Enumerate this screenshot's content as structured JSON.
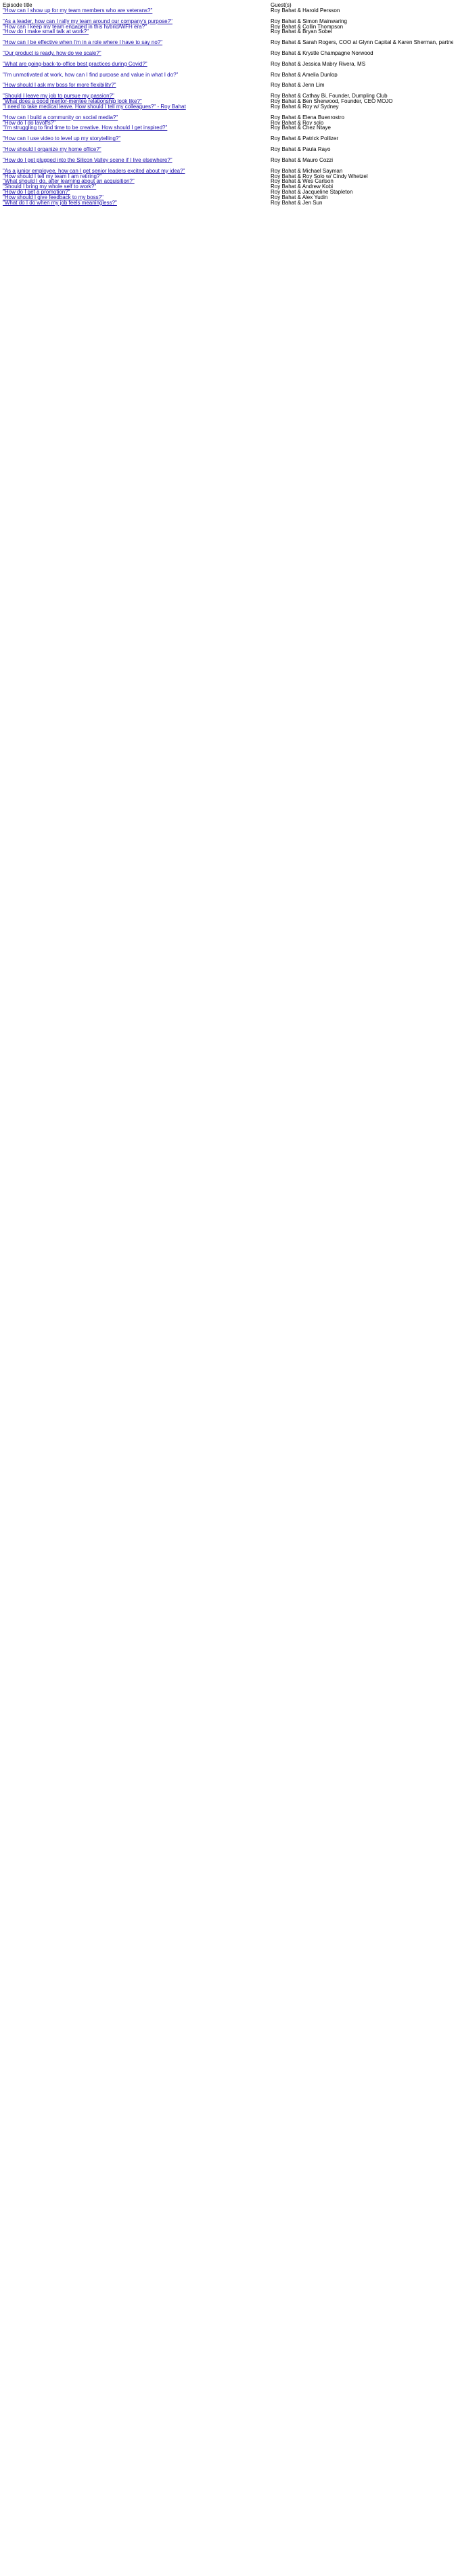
{
  "headers": {
    "title": "Episode title",
    "guests": "Guest(s)"
  },
  "colors": {
    "link": "#1a0dab",
    "text": "#000000",
    "background": "#ffffff"
  },
  "groups": [
    {
      "rows": [
        {
          "title": "\"How can I show up for my team members who are veterans?\"",
          "guest": "Roy Bahat & Harold Persson"
        }
      ]
    },
    {
      "rows": [
        {
          "title": "\"As a leader, how can I rally my team around our company's purpose?\"",
          "guest": "Roy Bahat & Simon Mainwaring"
        },
        {
          "title": "\"How can I keep my team engaged in this hybrid/WFH era?\"",
          "guest": "Roy Bahat & Collin Thompson"
        },
        {
          "title": "\"How do I make small talk at work?\"",
          "guest": "Roy Bahat & Bryan Sobel"
        }
      ]
    },
    {
      "rows": [
        {
          "title": "\"How can I be effective when I'm in a role where I have to say no?\"",
          "guest": "Roy Bahat & Sarah Rogers, COO at Glynn Capital & Karen Sherman, partner at Greylock"
        }
      ]
    },
    {
      "rows": [
        {
          "title": "\"Our product is ready, how do we scale?\"",
          "guest": "Roy Bahat & Krystle Champagne Norwood"
        }
      ]
    },
    {
      "rows": [
        {
          "title": "\"What are going-back-to-office best practices during Covid?\"",
          "guest": "Roy Bahat & Jessica Mabry Rivera, MS"
        }
      ]
    },
    {
      "rows": [
        {
          "title": "\"I'm unmotivated at work, how can I find purpose and value in what I do?\"",
          "guest": "Roy Bahat & Amelia Dunlop"
        }
      ]
    },
    {
      "rows": [
        {
          "title": "\"How should I ask my boss for more flexibility?\"",
          "guest": "Roy Bahat & Jenn Lim"
        }
      ]
    },
    {
      "rows": [
        {
          "title": "\"Should I leave my job to pursue my passion?\"",
          "guest": "Roy Bahat & Cathay Bi, Founder, Dumpling Club"
        },
        {
          "title": "\"What does a good mentor-mentee relationship look like?\"",
          "guest": "Roy Bahat & Ben Sherwood, Founder, CEO MOJO"
        },
        {
          "title": "\"I need to take medical leave. How should I tell my colleagues?\" - Roy Bahat",
          "guest": "Roy Bahat & Roy w/ Sydney"
        }
      ]
    },
    {
      "rows": [
        {
          "title": "\"How can I build a community on social media?\"",
          "guest": "Roy Bahat & Elena Buenrostro"
        },
        {
          "title": "\"How do I do layoffs?\"",
          "guest": "Roy Bahat & Roy solo"
        },
        {
          "title": "\"I'm struggling to find time to be creative. How should I get inspired?\"",
          "guest": "Roy Bahat & Chez Ntaye"
        }
      ]
    },
    {
      "rows": [
        {
          "title": "\"How can I use video to level up my storytelling?\"",
          "guest": "Roy Bahat & Patrick Pollizer"
        }
      ]
    },
    {
      "rows": [
        {
          "title": "\"How should I organize my home office?\"",
          "guest": "Roy Bahat & Paula Rayo"
        }
      ]
    },
    {
      "rows": [
        {
          "title": "\"How do I get plugged into the Silicon Valley scene if I live elsewhere?\"",
          "guest": "Roy Bahat & Mauro Cozzi"
        }
      ]
    },
    {
      "rows": [
        {
          "title": "\"As a junior employee, how can I get senior leaders excited about my idea?\"",
          "guest": "Roy Bahat & Michael Sayman"
        },
        {
          "title": "\"How should I tell my team I am retiring?\"",
          "guest": "Roy Bahat & Roy Solo w/ Cindy Whetzel"
        },
        {
          "title": "\"What should I do, after learning about an acquisition?\"",
          "guest": "Roy Bahat & Wes Carlson"
        },
        {
          "title": "\"Should I bring my whole self to work?\"",
          "guest": "Roy Bahat & Andrew Kobi"
        },
        {
          "title": "\"How do I get a promotion?\"",
          "guest": "Roy Bahat & Jacqueline Stapleton"
        },
        {
          "title": "\"How should I give feedback to my boss?\"",
          "guest": "Roy Bahat & Alex Yudin"
        },
        {
          "title": "\"What do I do when my job feels meaningless?\"",
          "guest": "Roy Bahat & Jen Sun"
        }
      ]
    }
  ]
}
